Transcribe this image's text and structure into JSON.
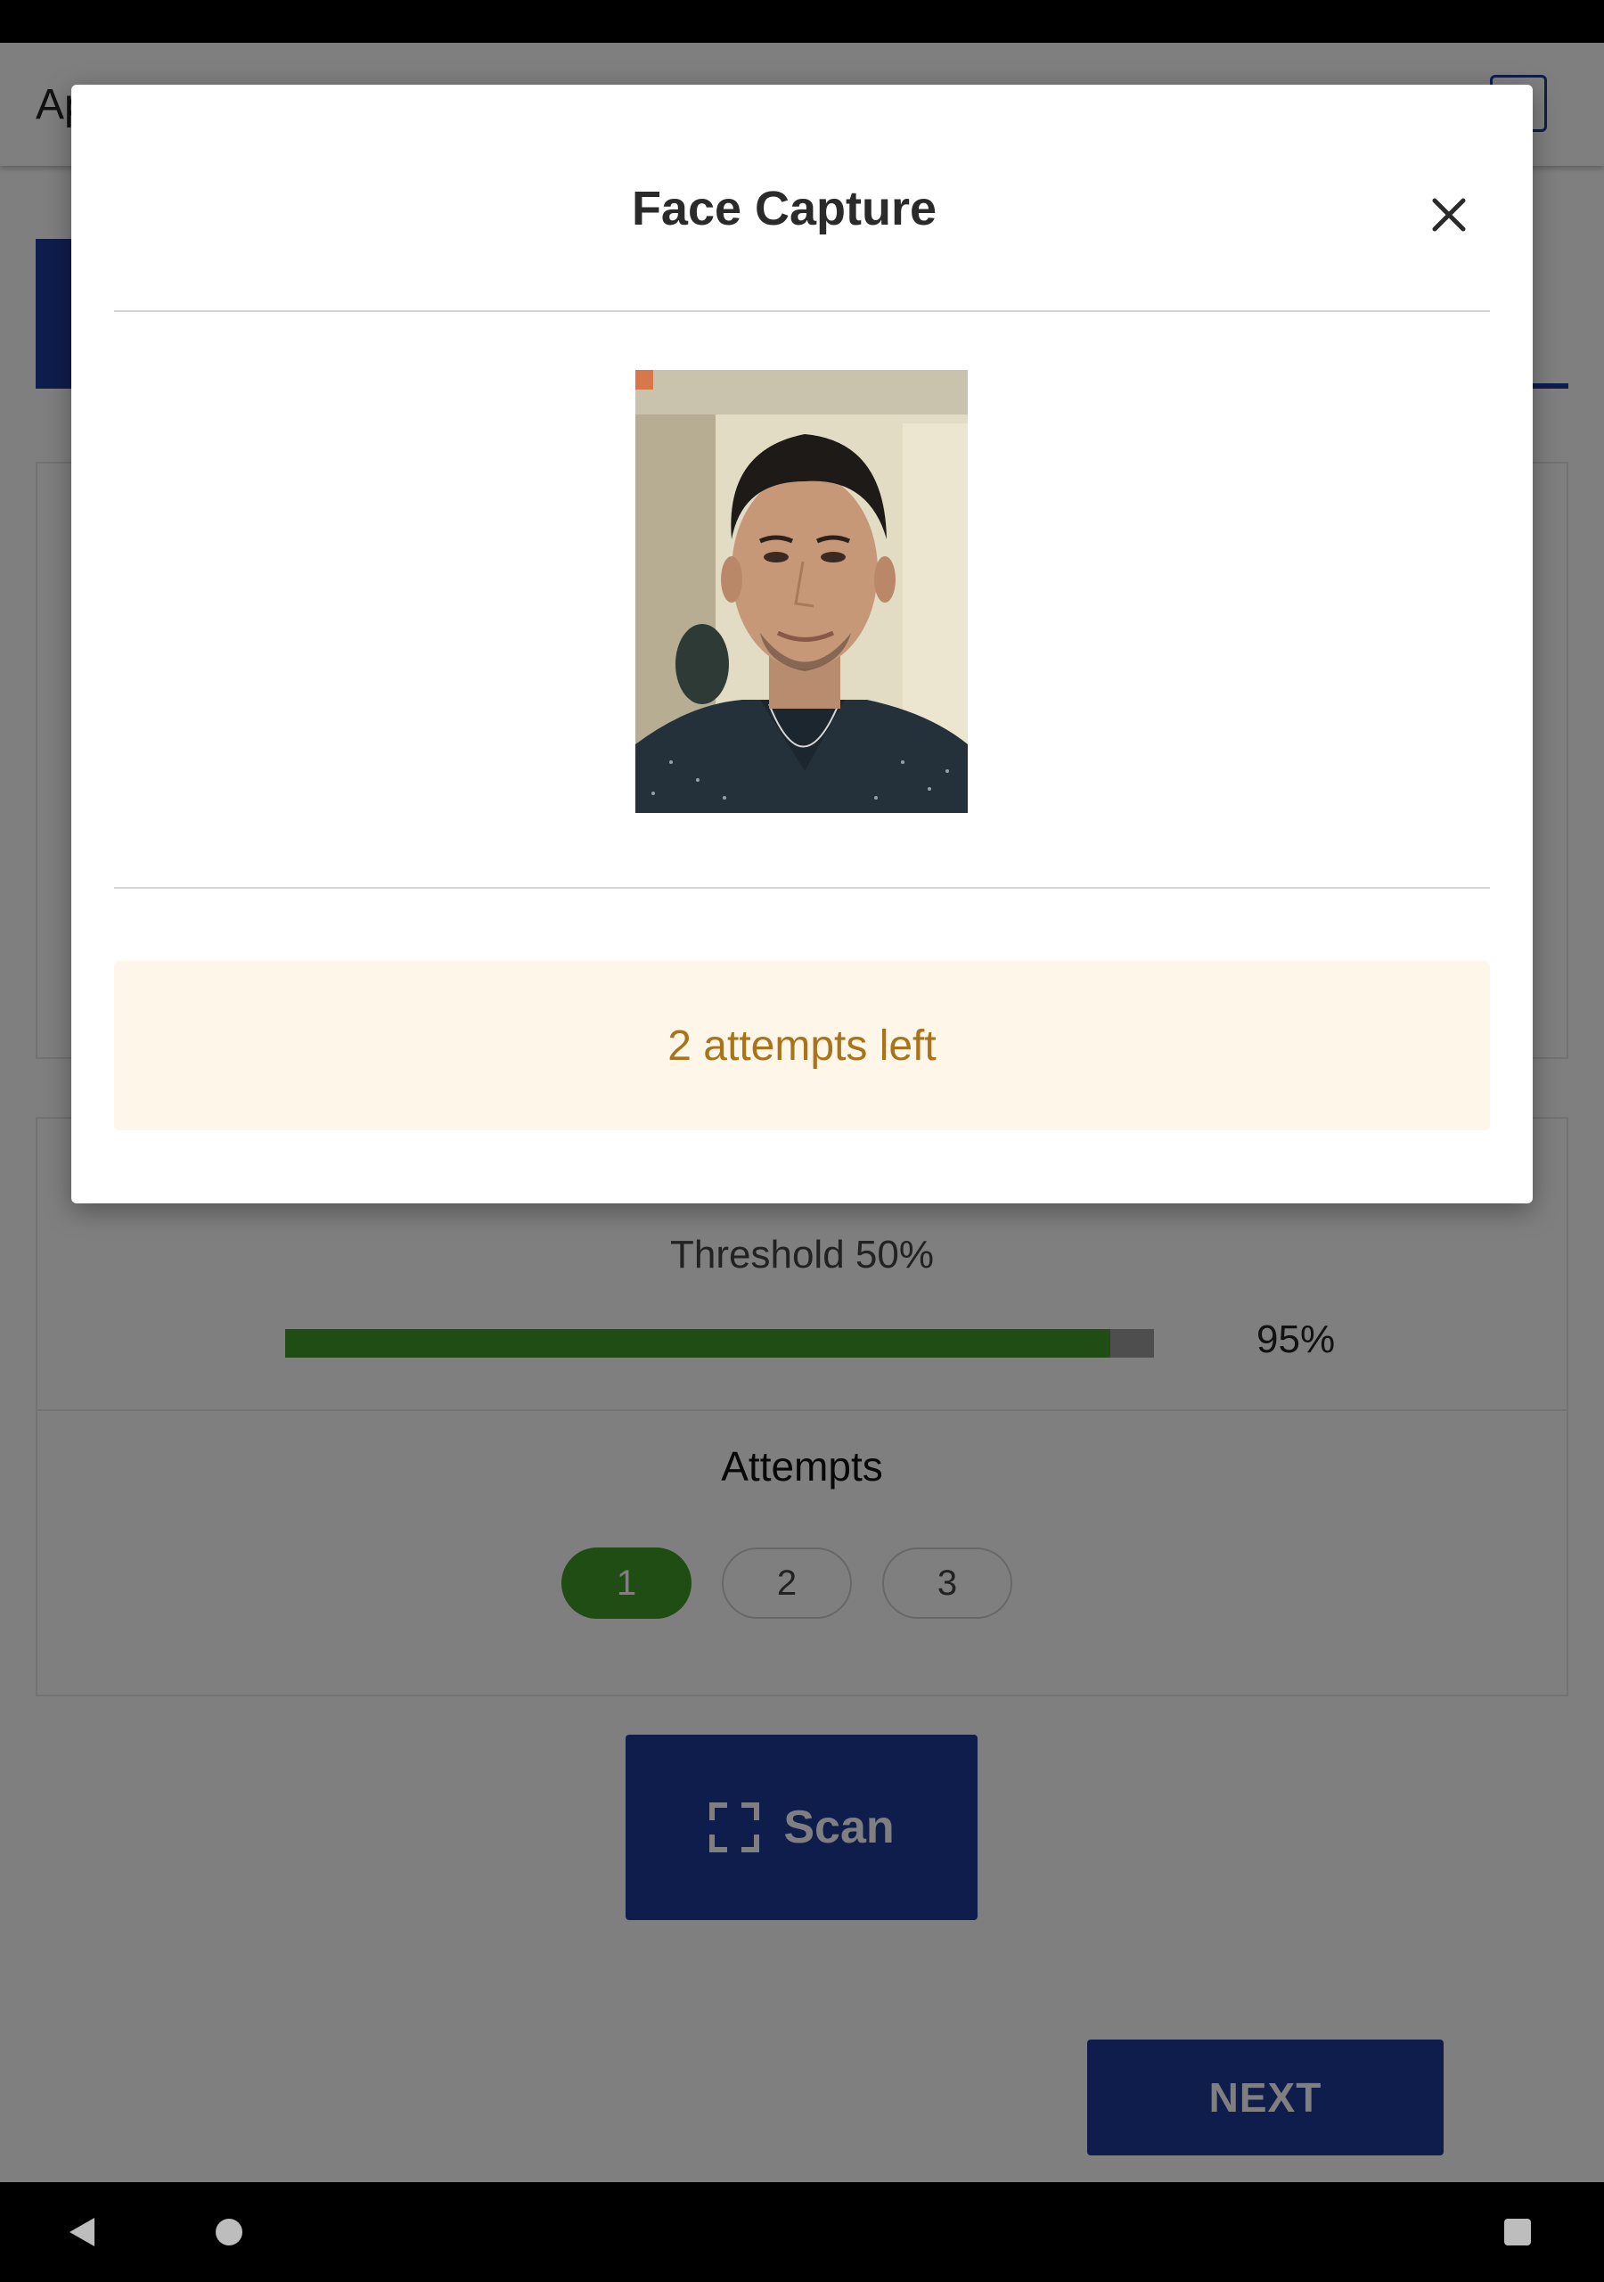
{
  "app": {
    "title_partial": "Ap"
  },
  "background": {
    "threshold_label": "Threshold 50%",
    "score": {
      "fraction": 0.95,
      "label": "95%"
    },
    "attempts_title": "Attempts",
    "attempt_pills": [
      {
        "label": "1",
        "active": true
      },
      {
        "label": "2",
        "active": false
      },
      {
        "label": "3",
        "active": false
      }
    ],
    "scan_label": "Scan",
    "next_label": "NEXT"
  },
  "modal": {
    "title": "Face Capture",
    "close_icon": "close-icon",
    "photo_alt": "captured-face-photo",
    "alert_text": "2 attempts left"
  },
  "colors": {
    "primary": "#1e3a9a",
    "success": "#3f9a28",
    "warning_text": "#a8741a",
    "warning_bg": "#fff6ea"
  },
  "navigation": {
    "back_icon": "back-icon",
    "home_icon": "home-icon",
    "recents_icon": "recents-icon"
  }
}
